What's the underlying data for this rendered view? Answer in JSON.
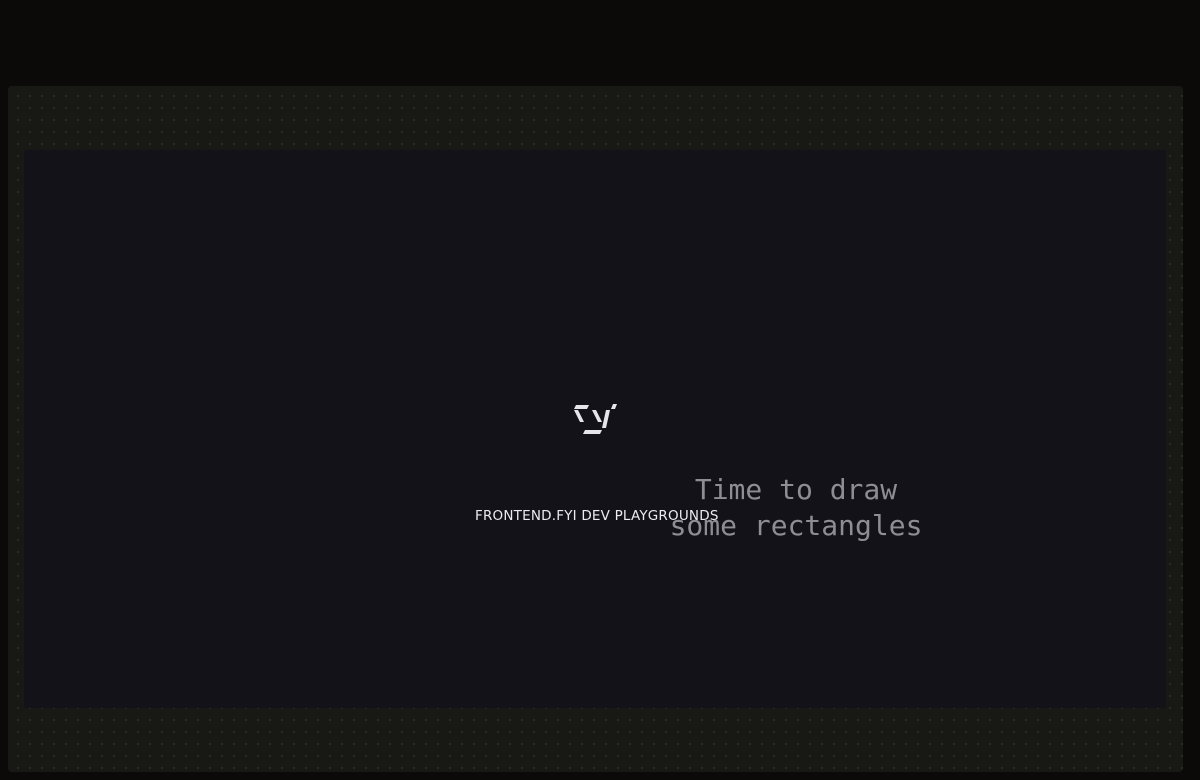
{
  "playground": {
    "logo_icon": "fyi-logo-icon",
    "caption": "FRONTEND.FYI DEV PLAYGROUNDS",
    "headline_line1": "Time to draw",
    "headline_line2": "some rectangles"
  },
  "colors": {
    "page_background": "#0b0a08",
    "frame_background": "#181815",
    "canvas_background": "#131219",
    "logo": "#e6e5ea",
    "caption_text": "#ecebf2",
    "headline_text": "#8e8d93"
  }
}
